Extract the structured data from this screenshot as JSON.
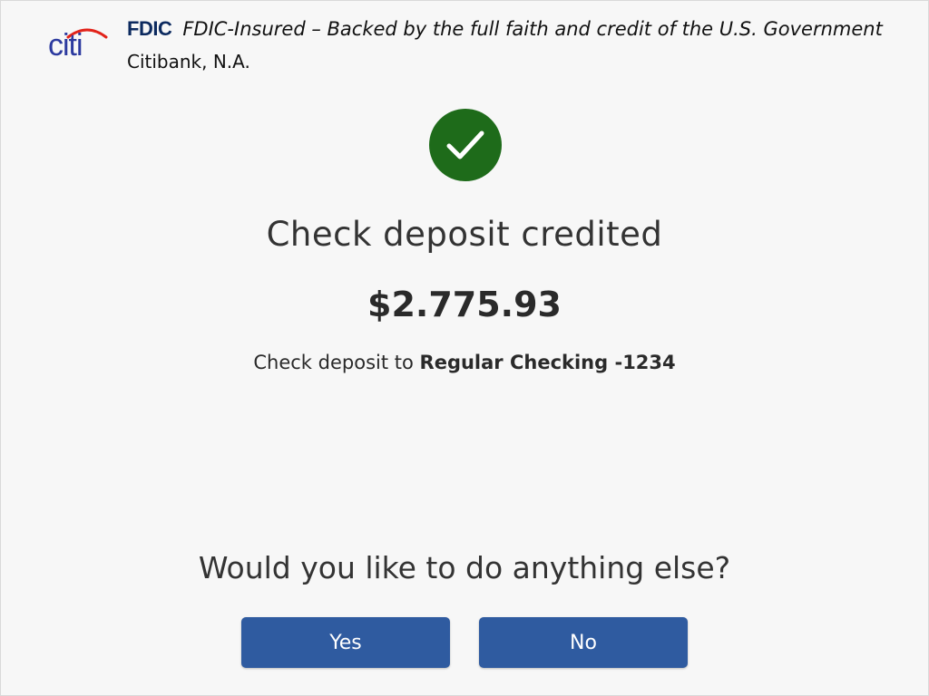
{
  "header": {
    "brand_logo_text": "citi",
    "fdic_logo_text": "FDIC",
    "fdic_statement": "FDIC-Insured – Backed by the full faith and credit of the U.S. Government",
    "bank_name": "Citibank, N.A."
  },
  "confirmation": {
    "status_icon": "check-circle-icon",
    "title": "Check deposit credited",
    "amount": "$2.775.93",
    "deposit_prefix": "Check deposit to",
    "account_name": "Regular Checking -1234"
  },
  "prompt": {
    "question": "Would you like to do anything else?",
    "yes_label": "Yes",
    "no_label": "No"
  },
  "colors": {
    "success_green": "#1e6b1a",
    "button_blue": "#2f5ba0",
    "citi_blue": "#2c3a9f",
    "citi_red": "#e2231a",
    "fdic_navy": "#0c2a5f"
  }
}
